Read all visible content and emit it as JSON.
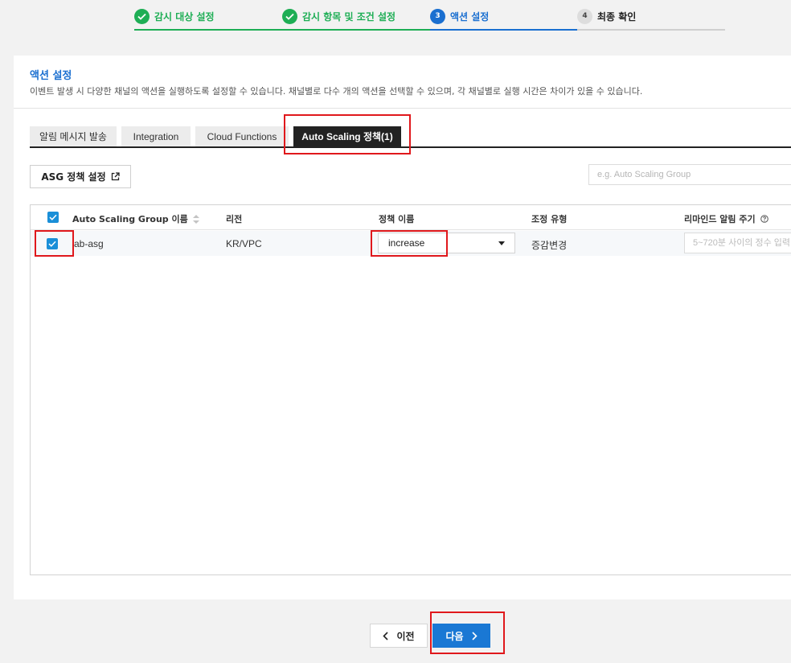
{
  "stepper": {
    "steps": [
      {
        "num": "",
        "label": "감시 대상 설정",
        "state": "done"
      },
      {
        "num": "",
        "label": "감시 항목 및 조건 설정",
        "state": "done"
      },
      {
        "num": "3",
        "label": "액션 설정",
        "state": "active"
      },
      {
        "num": "4",
        "label": "최종 확인",
        "state": "todo"
      }
    ]
  },
  "section": {
    "title": "액션 설정",
    "description": "이벤트 발생 시 다양한 채널의 액션을 실행하도록 설정할 수 있습니다. 채널별로 다수 개의 액션을 선택할 수 있으며, 각 채널별로 실행 시간은 차이가 있을 수 있습니다."
  },
  "tabs": [
    {
      "label": "알림 메시지 발송",
      "active": false
    },
    {
      "label": "Integration",
      "active": false
    },
    {
      "label": "Cloud Functions",
      "active": false
    },
    {
      "label": "Auto Scaling 정책(1)",
      "active": true
    }
  ],
  "toolbar": {
    "asg_button_label": "ASG 정책 설정",
    "search_placeholder": "e.g. Auto Scaling Group"
  },
  "table": {
    "columns": [
      "Auto Scaling Group 이름",
      "리전",
      "정책 이름",
      "조정 유형",
      "리마인드 알림 주기"
    ],
    "rows": [
      {
        "name": "ab-asg",
        "region": "KR/VPC",
        "policy": "increase",
        "adjust_type": "증감변경",
        "remind_placeholder": "5~720분 사이의 정수 입력"
      }
    ]
  },
  "footer": {
    "prev_label": "이전",
    "next_label": "다음"
  },
  "colors": {
    "done": "#1eae55",
    "active": "#1a6fd0",
    "highlight": "#e0181c",
    "primary_button": "#1a78d4"
  }
}
